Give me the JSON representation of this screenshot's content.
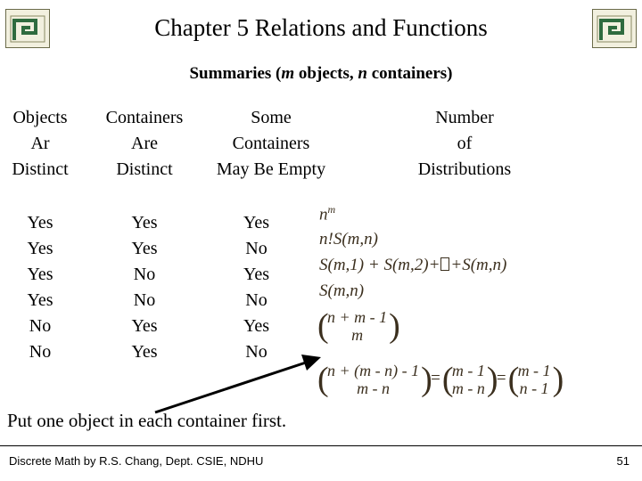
{
  "slide": {
    "title": "Chapter 5 Relations and Functions",
    "subtitle_prefix": "Summaries (",
    "subtitle_m": "m",
    "subtitle_mid": " objects, ",
    "subtitle_n": "n",
    "subtitle_suffix": " containers)"
  },
  "table": {
    "headers": [
      {
        "name": "objects",
        "lines": [
          "Objects",
          "Ar",
          "Distinct"
        ]
      },
      {
        "name": "containers",
        "lines": [
          "Containers",
          "Are",
          "Distinct"
        ]
      },
      {
        "name": "some-empty",
        "lines": [
          "Some",
          "Containers",
          "May Be Empty"
        ]
      },
      {
        "name": "distributions",
        "lines": [
          "Number",
          "of",
          "Distributions"
        ]
      }
    ],
    "col_objects": [
      "Yes",
      "Yes",
      "Yes",
      "Yes",
      "No",
      "No"
    ],
    "col_containers": [
      "Yes",
      "Yes",
      "No",
      "No",
      "Yes",
      "Yes"
    ],
    "col_empty": [
      "Yes",
      "No",
      "Yes",
      "No",
      "Yes",
      "No"
    ],
    "formulas": [
      "n^m",
      "n!S(m,n)",
      "S(m,1) + S(m,2)+ ⬚  +S(m,n)",
      "S(m,n)",
      "(n + m - 1 choose m)",
      "(n + (m - n) - 1 choose m - n) = (m - 1 choose m - n) = (m - 1 choose n - 1)"
    ]
  },
  "formula_parts": {
    "f1_base": "n",
    "f1_exp": "m",
    "f2": "n!S(m,n)",
    "f3_left": "S(m,1) + S(m,2)+",
    "f3_right": "+S(m,n)",
    "f4": "S(m,n)",
    "f5_top": "n + m - 1",
    "f5_bot": "m",
    "f6_a_top": "n + (m - n) - 1",
    "f6_a_bot": "m - n",
    "f6_eq1": "=",
    "f6_b_top": "m - 1",
    "f6_b_bot": "m - n",
    "f6_eq2": "=",
    "f6_c_top": "m - 1",
    "f6_c_bot": "n - 1"
  },
  "note": "Put one object in each container first.",
  "footer": {
    "credit": "Discrete Math by R.S. Chang, Dept. CSIE, NDHU",
    "page": "51"
  }
}
